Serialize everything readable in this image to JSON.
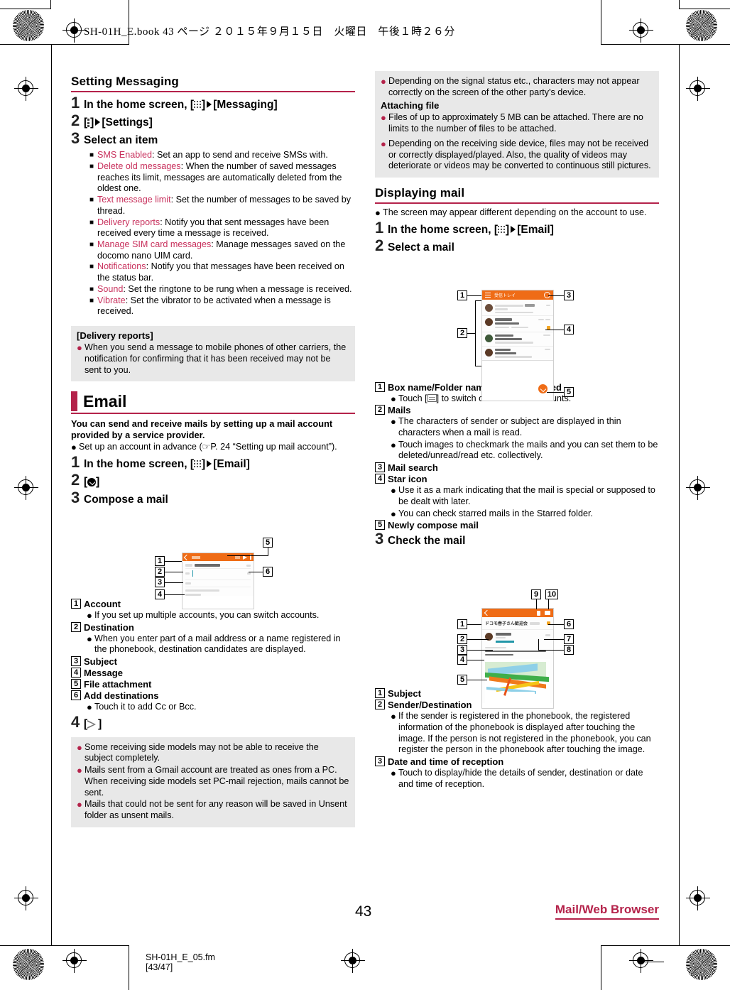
{
  "print": {
    "header": "SH-01H_E.book  43 ページ  ２０１５年９月１５日　火曜日　午後１時２６分",
    "footer_file": "SH-01H_E_05.fm",
    "footer_range": "[43/47]",
    "page_number": "43",
    "chapter_tag": "Mail/Web Browser",
    "accent_color": "#b4224a",
    "keyword_color": "#c8305c",
    "screenshot_bar_color": "#ef6c16"
  },
  "left": {
    "setting_messaging": {
      "title": "Setting Messaging",
      "steps": [
        {
          "n": "1",
          "text_pre": "In the home screen, [",
          "icon": "apps-grid-icon",
          "text_mid": "]",
          "arrow": "play-arrow-icon",
          "text_post": "[Messaging]"
        },
        {
          "n": "2",
          "text_pre": "[",
          "icon": "overflow-menu-icon",
          "text_mid": "]",
          "arrow": "play-arrow-icon",
          "text_post": "[Settings]"
        },
        {
          "n": "3",
          "text_post": "Select an item"
        }
      ],
      "items": [
        {
          "kw": "SMS Enabled",
          "desc": ": Set an app to send and receive SMSs with."
        },
        {
          "kw": "Delete old messages",
          "desc": ": When the number of saved messages reaches its limit, messages are automatically deleted from the oldest one."
        },
        {
          "kw": "Text message limit",
          "desc": ": Set the number of messages to be saved by thread."
        },
        {
          "kw": "Delivery reports",
          "desc": ": Notify you that sent messages have been received every time a message is received."
        },
        {
          "kw": "Manage SIM card messages",
          "desc": ": Manage messages saved on the docomo nano UIM card."
        },
        {
          "kw": "Notifications",
          "desc": ": Notify you that messages have been received on the status bar."
        },
        {
          "kw": "Sound",
          "desc": ": Set the ringtone to be rung when a message is received."
        },
        {
          "kw": "Vibrate",
          "desc": ": Set the vibrator to be activated when a message is received."
        }
      ],
      "note": {
        "heading": "[Delivery reports]",
        "bullets": [
          "When you send a message to mobile phones of other carriers, the notification for confirming that it has been received may not be sent to you."
        ]
      }
    },
    "email": {
      "title": "Email",
      "lead": "You can send and receive mails by setting up a mail account provided by a service provider.",
      "lead_bullet_pre": "Set up an account in advance (",
      "lead_bullet_ref": "P. 24 “Setting up mail account”).",
      "steps": [
        {
          "n": "1",
          "text_pre": "In the home screen, [",
          "icon": "apps-grid-icon",
          "text_mid": "]",
          "arrow": "play-arrow-icon",
          "text_post": "[Email]"
        },
        {
          "n": "2",
          "text_pre": "[",
          "icon": "compose-circle-icon",
          "text_mid": "]"
        },
        {
          "n": "3",
          "text_post": "Compose a mail"
        },
        {
          "n": "4",
          "text_pre": "[",
          "icon": "send-arrow-icon",
          "text_mid": "]"
        }
      ],
      "callouts": [
        {
          "n": "1",
          "label": "Account",
          "bullets": [
            "If you set up multiple accounts, you can switch accounts."
          ]
        },
        {
          "n": "2",
          "label": "Destination",
          "bullets": [
            "When you enter part of a mail address or a name registered in the phonebook, destination candidates are displayed."
          ]
        },
        {
          "n": "3",
          "label": "Subject",
          "bullets": []
        },
        {
          "n": "4",
          "label": "Message",
          "bullets": []
        },
        {
          "n": "5",
          "label": "File attachment",
          "bullets": []
        },
        {
          "n": "6",
          "label": "Add destinations",
          "bullets": [
            "Touch it to add Cc or Bcc."
          ]
        }
      ],
      "note": {
        "bullets": [
          "Some receiving side models may not be able to receive the subject completely.",
          "Mails sent from a Gmail account are treated as ones from a PC. When receiving side models set PC-mail rejection, mails cannot be sent.",
          "Mails that could not be sent for any reason will be saved in Unsent folder as unsent mails."
        ]
      },
      "compose_shot": {
        "name": "compose-mail-screenshot",
        "bar_title": "作成",
        "callout_numbers": [
          "1",
          "2",
          "3",
          "4",
          "5",
          "6"
        ]
      }
    }
  },
  "right": {
    "top_note": {
      "bullets_before": [
        "Depending on the signal status etc., characters may not appear correctly on the screen of the other party's device."
      ],
      "sub_heading": "Attaching file",
      "bullets_after": [
        "Files of up to approximately 5 MB can be attached. There are no limits to the number of files to be attached.",
        "Depending on the receiving side device, files may not be received or correctly displayed/played. Also, the quality of videos may deteriorate or videos may be converted to continuous still pictures."
      ]
    },
    "displaying_mail": {
      "title": "Displaying mail",
      "lead_bullet": "The screen may appear different depending on the account to use.",
      "steps": [
        {
          "n": "1",
          "text_pre": "In the home screen, [",
          "icon": "apps-grid-icon",
          "text_mid": "]",
          "arrow": "play-arrow-icon",
          "text_post": "[Email]"
        },
        {
          "n": "2",
          "text_post": "Select a mail"
        },
        {
          "n": "3",
          "text_post": "Check the mail"
        }
      ],
      "list_callouts": [
        {
          "n": "1",
          "label": "Box name/Folder name being displayed",
          "bullets_pre": "Touch [",
          "bullet_icon": "hamburger-list-icon",
          "bullets_post": "] to switch or set folders/accounts."
        },
        {
          "n": "2",
          "label": "Mails",
          "bullets": [
            "The characters of sender or subject are displayed in thin characters when a mail is read.",
            "Touch images to checkmark the mails and you can set them to be deleted/unread/read etc. collectively."
          ]
        },
        {
          "n": "3",
          "label": "Mail search",
          "bullets": []
        },
        {
          "n": "4",
          "label": "Star icon",
          "bullets": [
            "Use it as a mark indicating that the mail is special or supposed to be dealt with later.",
            "You can check starred mails in the Starred folder."
          ]
        },
        {
          "n": "5",
          "label": "Newly compose mail",
          "bullets": []
        }
      ],
      "detail_callouts": [
        {
          "n": "1",
          "label": "Subject",
          "bullets": []
        },
        {
          "n": "2",
          "label": "Sender/Destination",
          "bullets": [
            "If the sender is registered in the phonebook, the registered information of the phonebook is displayed after touching the image. If the person is not registered in the phonebook, you can register the person in the phonebook after touching the image."
          ]
        },
        {
          "n": "3",
          "label": "Date and time of reception",
          "bullets": [
            "Touch to display/hide the details of sender, destination or date and time of reception."
          ]
        }
      ],
      "inbox_shot": {
        "name": "mail-inbox-screenshot",
        "bar_title": "受信トレイ",
        "rows": [
          {
            "sender": "docomotaro@icloud.com",
            "subject": "予定確認",
            "preview": "次の打合せの予定はいつになりますか。よろしく",
            "read": true,
            "star": false
          },
          {
            "sender": "情報 花子",
            "subject": "ドコモ夢タウン商店街",
            "preview": "新春のセール　情報交換会を行います",
            "read": false,
            "star": true
          },
          {
            "sender": "ドコモ 太郎",
            "subject": "ホームパーティーの件",
            "preview": "来月に計画しているホームパーティーですが",
            "read": false,
            "star": false
          },
          {
            "sender": "情報 花子",
            "subject": "打ち合わせの場所",
            "preview": "ドコモ夢タウンの商店街ですが、よろしく",
            "read": false,
            "star": false
          }
        ],
        "callout_numbers": [
          "1",
          "2",
          "3",
          "4",
          "5"
        ]
      },
      "detail_shot": {
        "name": "mail-detail-screenshot",
        "subject": "ドコモ春子さん歓迎会",
        "sender": "情報 花子",
        "callout_numbers": [
          "1",
          "2",
          "3",
          "4",
          "5",
          "6",
          "7",
          "8",
          "9",
          "10"
        ]
      }
    }
  }
}
